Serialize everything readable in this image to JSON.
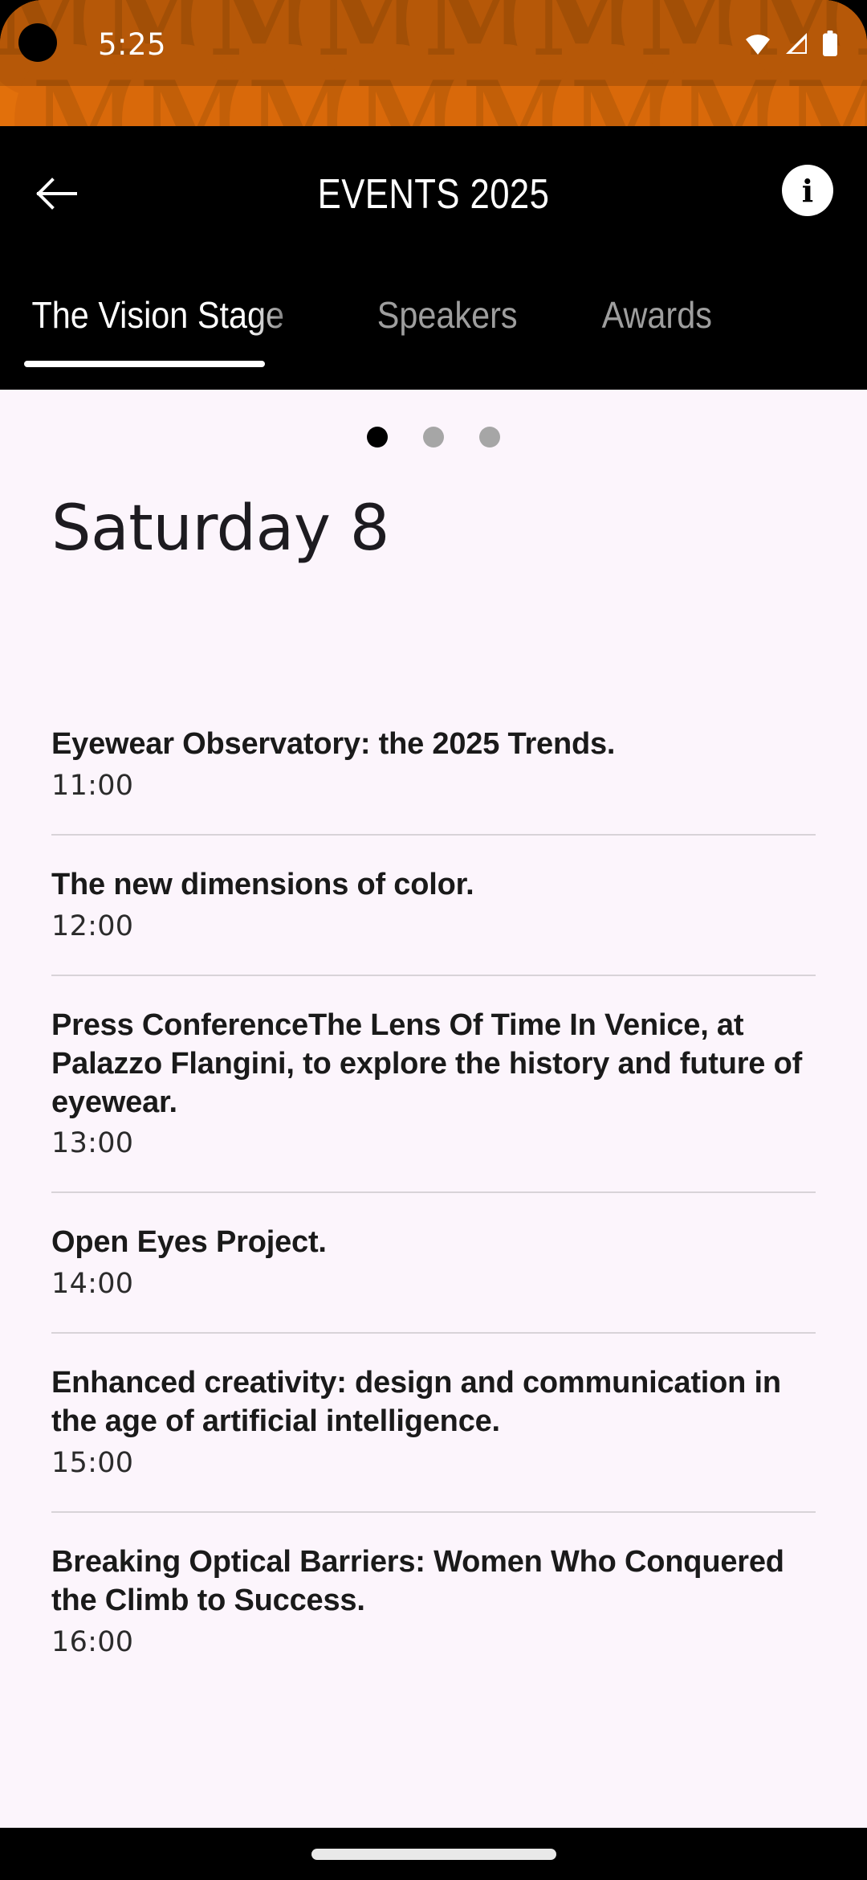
{
  "status_bar": {
    "time": "5:25",
    "icons": [
      "wifi-icon",
      "signal-icon",
      "battery-icon"
    ],
    "brand_letter": "M",
    "background_color": "#E2700B",
    "scrim_color": "#BF5A0B"
  },
  "app_bar": {
    "back_label": "back-arrow",
    "title": "EVENTS 2025",
    "info_label": "i"
  },
  "tabs": {
    "items": [
      {
        "label": "The Vision Stage",
        "active": true
      },
      {
        "label": "Speakers",
        "active": false
      },
      {
        "label": "Awards",
        "active": false
      }
    ]
  },
  "pager": {
    "dots": [
      {
        "active": true
      },
      {
        "active": false
      },
      {
        "active": false
      }
    ]
  },
  "schedule": {
    "day_title": "Saturday 8",
    "events": [
      {
        "title": "Eyewear Observatory: the 2025 Trends.",
        "time": "11:00"
      },
      {
        "title": "The new dimensions of color.",
        "time": "12:00"
      },
      {
        "title": "Press ConferenceThe Lens Of Time In Venice, at Palazzo Flangini, to explore the history and future of eyewear.",
        "time": "13:00"
      },
      {
        "title": "Open Eyes Project.",
        "time": "14:00"
      },
      {
        "title": "Enhanced creativity: design and communication in the age of artificial intelligence.",
        "time": "15:00"
      },
      {
        "title": "Breaking Optical Barriers: Women Who Conquered the Climb to Success.",
        "time": "16:00"
      }
    ]
  },
  "nav_bar": {
    "gesture_pill": "home-indicator"
  },
  "colors": {
    "accent_orange": "#E2700B",
    "content_background": "#FCF5FC",
    "text_primary": "#1a1a1a",
    "divider": "#d8d3d8"
  }
}
